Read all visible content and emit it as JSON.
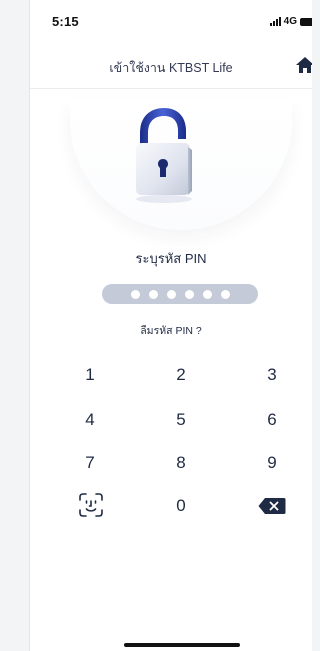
{
  "status_bar": {
    "time": "5:15",
    "network": "4G"
  },
  "header": {
    "title": "เข้าใช้งาน KTBST Life",
    "home_icon": "home-icon"
  },
  "lock": {
    "icon": "lock-icon"
  },
  "pin": {
    "title": "ระบุรหัส PIN",
    "entered_digits": 0,
    "length": 6,
    "forgot_label": "ลืมรหัส PIN ?"
  },
  "keypad": {
    "keys": [
      "1",
      "2",
      "3",
      "4",
      "5",
      "6",
      "7",
      "8",
      "9",
      "0"
    ],
    "face_id_icon": "face-id-icon",
    "delete_icon": "backspace-icon"
  },
  "colors": {
    "text_primary": "#1f2a44",
    "pin_box": "#c4cad8",
    "accent": "#1f2a44",
    "lock_blue": "#2b3ea6"
  }
}
